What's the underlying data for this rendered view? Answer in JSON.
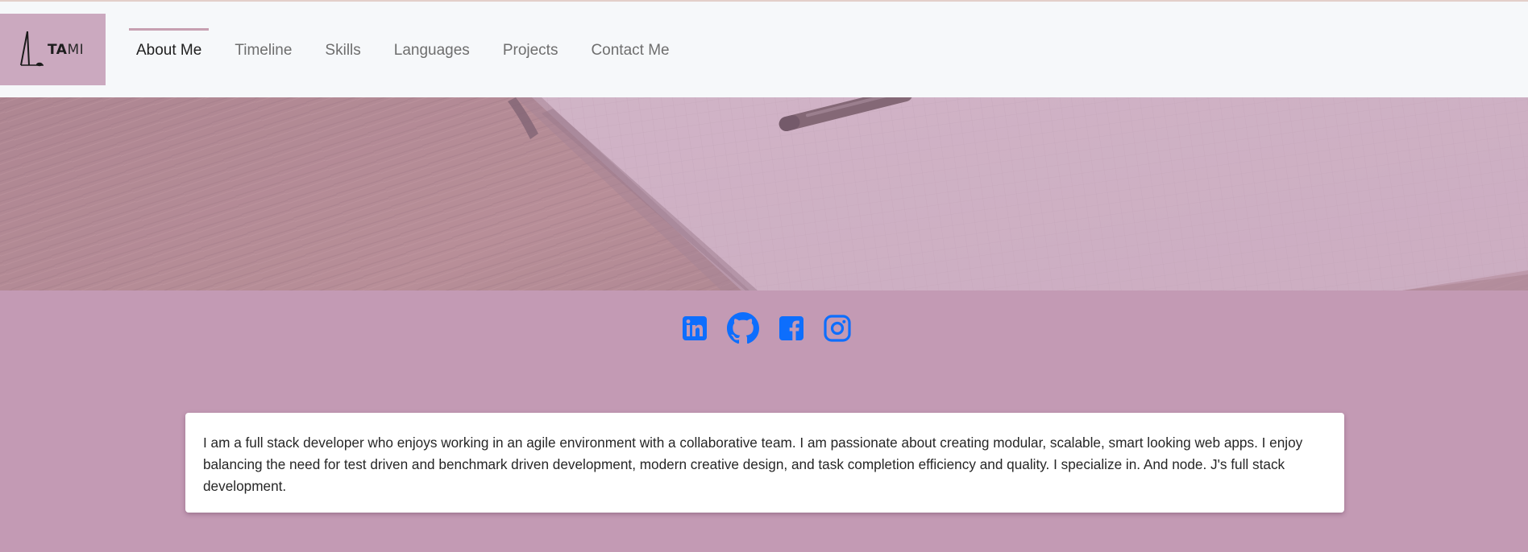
{
  "colors": {
    "page_background": "#c39ab4",
    "navbar_background": "#f6f8fa",
    "brand_background": "#cba9bf",
    "active_tab_accent": "#c7a0b1",
    "social_icon_color": "#0d6efd",
    "card_background": "#ffffff"
  },
  "brand": {
    "text_bold": "TA",
    "text_light": "MI",
    "icon": "easel-logo-icon"
  },
  "nav": {
    "items": [
      {
        "label": "About Me",
        "active": true
      },
      {
        "label": "Timeline",
        "active": false
      },
      {
        "label": "Skills",
        "active": false
      },
      {
        "label": "Languages",
        "active": false
      },
      {
        "label": "Projects",
        "active": false
      },
      {
        "label": "Contact Me",
        "active": false
      }
    ]
  },
  "hero": {
    "image": "desk-notebook-pen-photo"
  },
  "social": {
    "icons": [
      "linkedin-icon",
      "github-icon",
      "facebook-icon",
      "instagram-icon"
    ]
  },
  "about": {
    "text": "I am a full stack developer who enjoys working in an agile environment with a collaborative team. I am passionate about creating modular, scalable, smart looking web apps. I enjoy balancing the need for test driven and benchmark driven development, modern creative design, and task completion efficiency and quality. I specialize in. And node. J's full stack development."
  }
}
